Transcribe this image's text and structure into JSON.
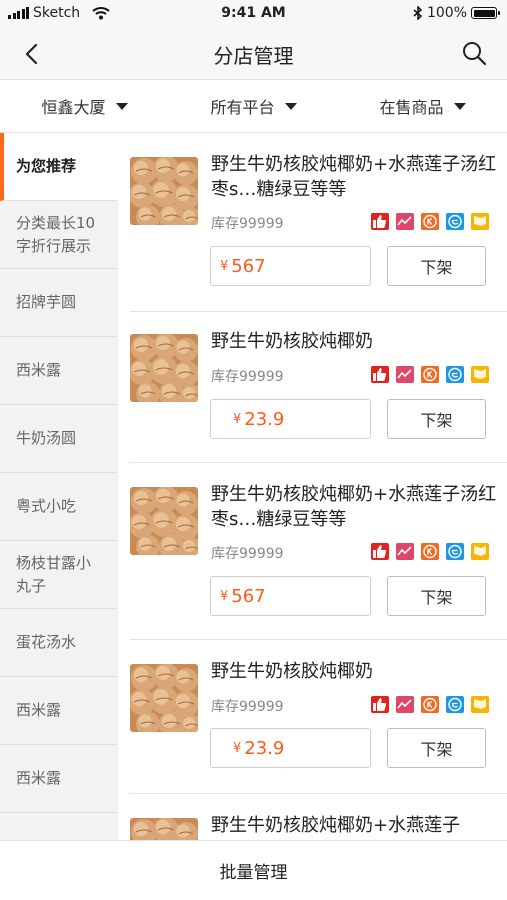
{
  "status_bar": {
    "carrier": "Sketch",
    "time": "9:41 AM",
    "battery": "100%"
  },
  "nav": {
    "title": "分店管理"
  },
  "filters": [
    {
      "label": "恒鑫大厦"
    },
    {
      "label": "所有平台"
    },
    {
      "label": "在售商品"
    }
  ],
  "sidebar": {
    "items": [
      {
        "label": "为您推荐",
        "active": true
      },
      {
        "label": "分类最长10字折行展示"
      },
      {
        "label": "招牌芋圆"
      },
      {
        "label": "西米露"
      },
      {
        "label": "牛奶汤圆"
      },
      {
        "label": "粤式小吃"
      },
      {
        "label": "杨枝甘露小丸子"
      },
      {
        "label": "蛋花汤水"
      },
      {
        "label": "西米露"
      },
      {
        "label": "西米露"
      }
    ]
  },
  "products": [
    {
      "name": "野生牛奶核胶炖椰奶+水燕莲子汤红枣s…糖绿豆等等",
      "stock": "库存99999",
      "currency": "¥",
      "price": "567",
      "action": "下架"
    },
    {
      "name": "野生牛奶核胶炖椰奶",
      "stock": "库存99999",
      "currency": "¥",
      "price": "23.9",
      "action": "下架"
    },
    {
      "name": "野生牛奶核胶炖椰奶+水燕莲子汤红枣s…糖绿豆等等",
      "stock": "库存99999",
      "currency": "¥",
      "price": "567",
      "action": "下架"
    },
    {
      "name": "野生牛奶核胶炖椰奶",
      "stock": "库存99999",
      "currency": "¥",
      "price": "23.9",
      "action": "下架"
    },
    {
      "name": "野生牛奶核胶炖椰奶+水燕莲子",
      "stock": "",
      "currency": "",
      "price": "",
      "action": ""
    }
  ],
  "platform_badges": [
    {
      "icon": "thumbs-up-icon",
      "color": "#e4211b"
    },
    {
      "icon": "chart-icon",
      "color": "#e0466a"
    },
    {
      "icon": "k-circle-icon",
      "color": "#f26a21"
    },
    {
      "icon": "e-circle-icon",
      "color": "#1e96e6"
    },
    {
      "icon": "flag-icon",
      "color": "#f7b500"
    }
  ],
  "colors": {
    "accent": "#ff6a1a",
    "price": "#ff5a1a"
  },
  "bottom_bar": {
    "label": "批量管理"
  }
}
